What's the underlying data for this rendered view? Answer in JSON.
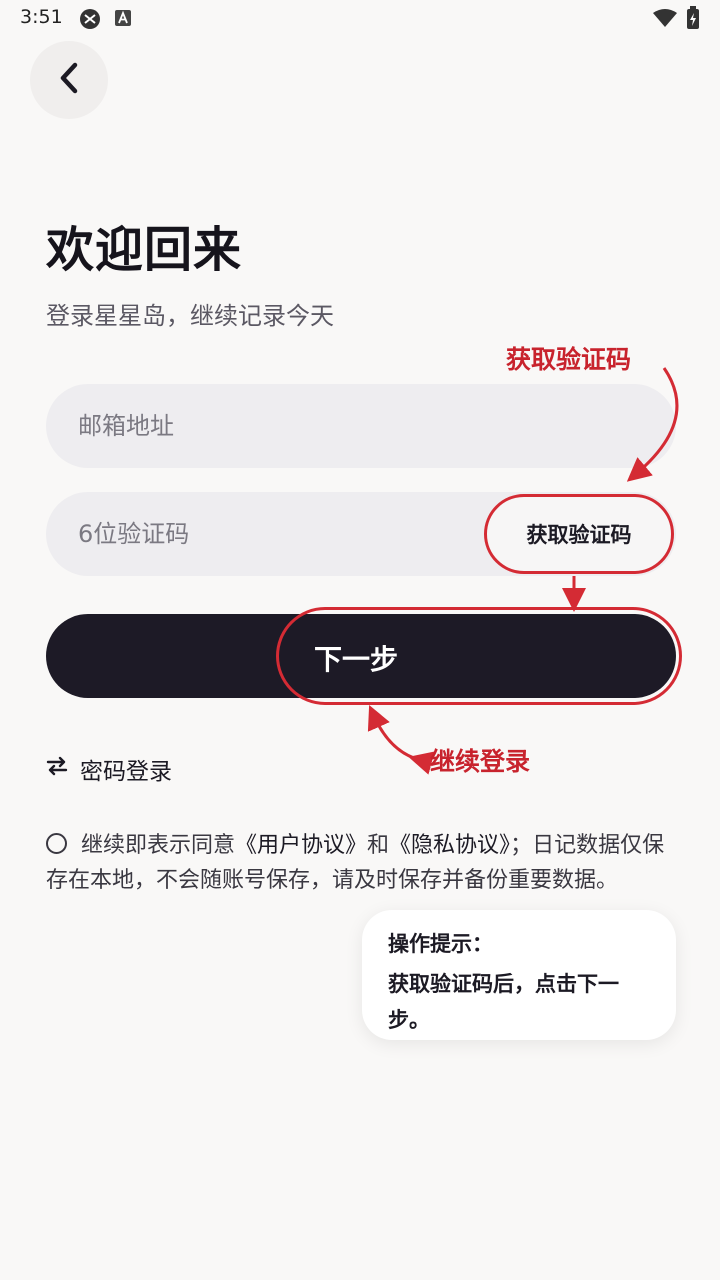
{
  "status_bar": {
    "time": "3:51"
  },
  "page": {
    "title": "欢迎回来",
    "subtitle": "登录星星岛，继续记录今天"
  },
  "form": {
    "email_placeholder": "邮箱地址",
    "code_placeholder": "6位验证码",
    "get_code_label": "获取验证码",
    "next_label": "下一步",
    "password_login_label": "密码登录"
  },
  "agreement": {
    "prefix": "继续即表示同意",
    "user_agreement": "《用户协议》",
    "and": "和",
    "privacy_agreement": "《隐私协议》",
    "suffix": "；日记数据仅保存在本地，不会随账号保存，请及时保存并备份重要数据。"
  },
  "annotations": {
    "get_code": "获取验证码",
    "continue_login": "继续登录",
    "accent_color": "#d42b34"
  },
  "tip": {
    "title": "操作提示：",
    "text": "获取验证码后，点击下一步。"
  },
  "colors": {
    "background": "#f9f8f7",
    "primary_button": "#1d1a26",
    "field_bg": "#eeedf0"
  }
}
